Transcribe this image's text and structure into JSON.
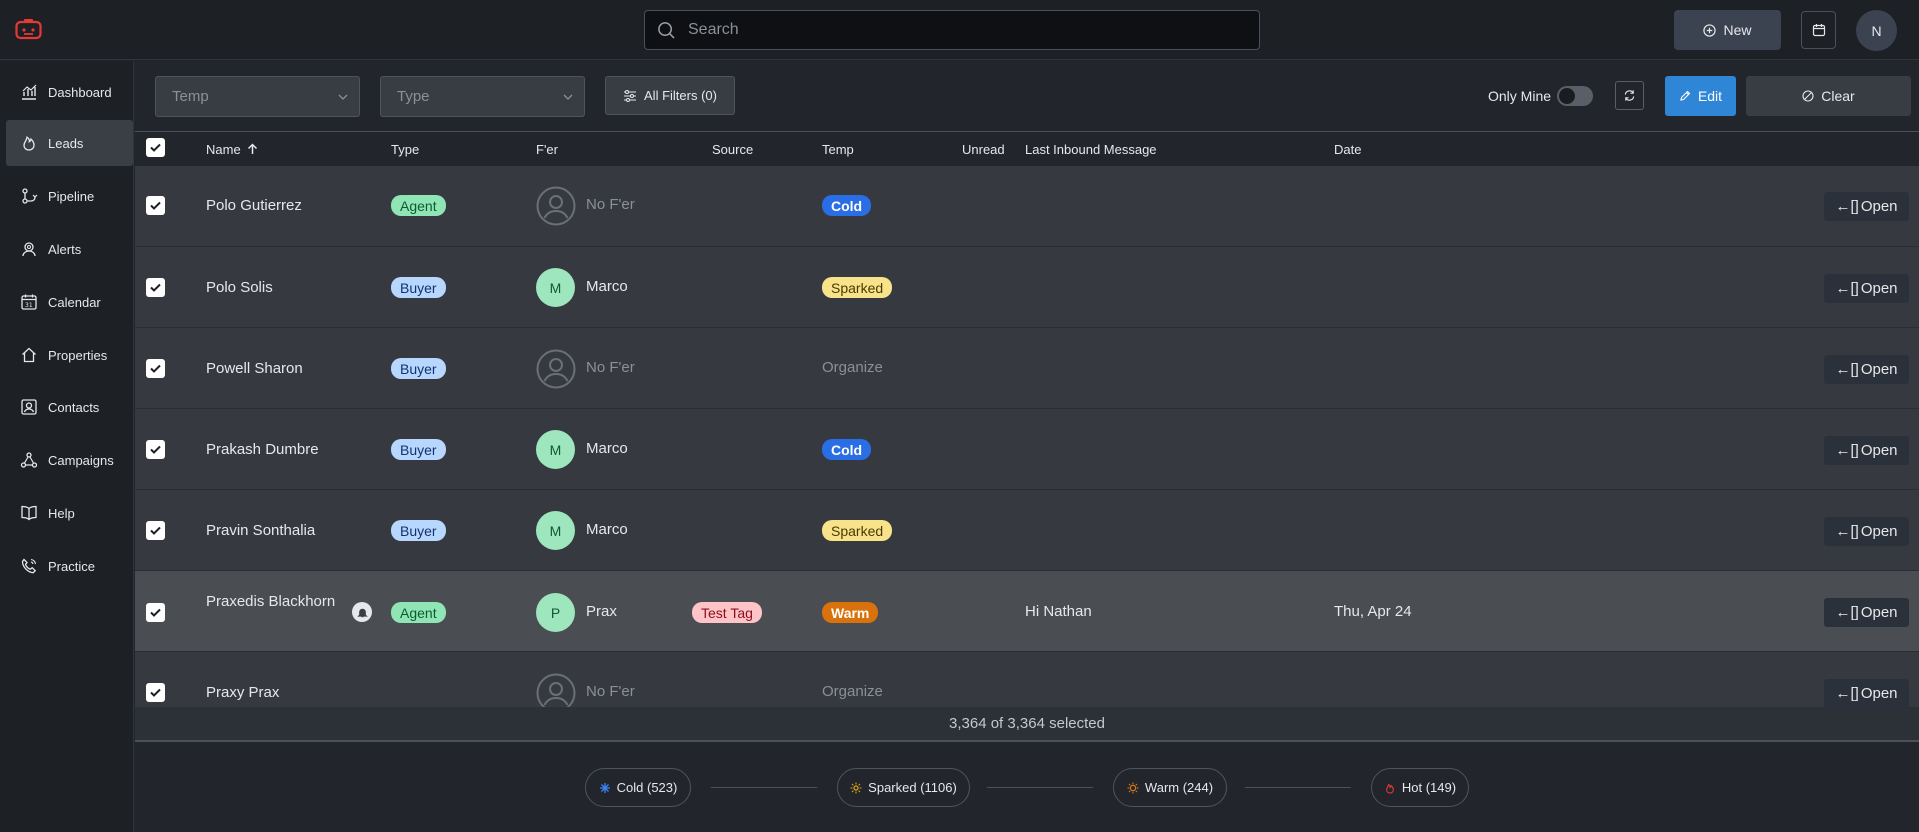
{
  "topbar": {
    "search_placeholder": "Search",
    "new_label": "New",
    "user_initial": "N"
  },
  "sidebar": {
    "items": [
      {
        "label": "Dashboard",
        "icon": "dashboard-icon"
      },
      {
        "label": "Leads",
        "icon": "fire-icon",
        "active": true
      },
      {
        "label": "Pipeline",
        "icon": "pipeline-icon"
      },
      {
        "label": "Alerts",
        "icon": "alerts-icon"
      },
      {
        "label": "Calendar",
        "icon": "calendar-icon"
      },
      {
        "label": "Properties",
        "icon": "home-icon"
      },
      {
        "label": "Contacts",
        "icon": "contacts-icon"
      },
      {
        "label": "Campaigns",
        "icon": "campaigns-icon"
      },
      {
        "label": "Help",
        "icon": "book-icon"
      },
      {
        "label": "Practice",
        "icon": "phone-icon"
      }
    ]
  },
  "filters": {
    "temp_placeholder": "Temp",
    "type_placeholder": "Type",
    "all_filters_label": "All Filters (0)",
    "only_mine_label": "Only Mine",
    "only_mine_on": false,
    "edit_label": "Edit",
    "clear_label": "Clear"
  },
  "table": {
    "columns": {
      "name": "Name",
      "type": "Type",
      "fer": "F'er",
      "source": "Source",
      "temp": "Temp",
      "unread": "Unread",
      "last_inbound": "Last Inbound Message",
      "date": "Date"
    },
    "open_label": "Open",
    "rows": [
      {
        "name": "Polo Gutierrez",
        "type": "Agent",
        "fer": "No F'er",
        "fer_initial": "",
        "source": "",
        "temp": "Cold",
        "last_inbound": "",
        "date": ""
      },
      {
        "name": "Polo Solis",
        "type": "Buyer",
        "fer": "Marco",
        "fer_initial": "M",
        "source": "",
        "temp": "Sparked",
        "last_inbound": "",
        "date": ""
      },
      {
        "name": "Powell Sharon",
        "type": "Buyer",
        "fer": "No F'er",
        "fer_initial": "",
        "source": "",
        "temp": "Organize",
        "last_inbound": "",
        "date": ""
      },
      {
        "name": "Prakash Dumbre",
        "type": "Buyer",
        "fer": "Marco",
        "fer_initial": "M",
        "source": "",
        "temp": "Cold",
        "last_inbound": "",
        "date": ""
      },
      {
        "name": "Pravin Sonthalia",
        "type": "Buyer",
        "fer": "Marco",
        "fer_initial": "M",
        "source": "",
        "temp": "Sparked",
        "last_inbound": "",
        "date": ""
      },
      {
        "name": "Praxedis Blackhorn",
        "type": "Agent",
        "fer": "Prax",
        "fer_initial": "P",
        "source": "Test Tag",
        "temp": "Warm",
        "last_inbound": "Hi Nathan",
        "date": "Thu, Apr 24",
        "bell": true
      },
      {
        "name": "Praxy Prax",
        "type": "",
        "fer": "No F'er",
        "fer_initial": "",
        "source": "",
        "temp": "Organize",
        "last_inbound": "",
        "date": ""
      }
    ],
    "selected_text": "3,364 of 3,364 selected"
  },
  "pipeline": {
    "stages": [
      {
        "label": "Cold (523)",
        "icon": "snowflake-icon",
        "color": "#3b82f6"
      },
      {
        "label": "Sparked (1106)",
        "icon": "spark-icon",
        "color": "#d9a514"
      },
      {
        "label": "Warm (244)",
        "icon": "sun-icon",
        "color": "#e07b12"
      },
      {
        "label": "Hot (149)",
        "icon": "flame-icon",
        "color": "#e53935"
      }
    ]
  },
  "colors": {
    "accent": "#2f86d6",
    "background": "#22262c",
    "row_bg": "#363940",
    "row_highlight": "#4a4d52"
  }
}
